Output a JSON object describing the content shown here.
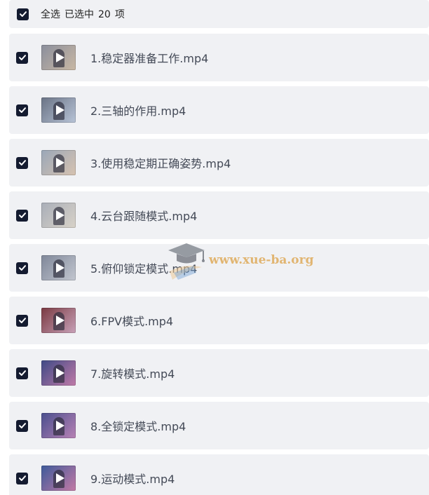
{
  "header": {
    "select_all_label": "全选",
    "selected_label": "已选中",
    "selected_count": "20",
    "count_unit": "项"
  },
  "files": [
    {
      "name": "1.稳定器准备工作.mp4",
      "thumb_colors": [
        "#8a8e9c",
        "#c9b8a4"
      ]
    },
    {
      "name": "2.三轴的作用.mp4",
      "thumb_colors": [
        "#6a7385",
        "#b7c3d6"
      ]
    },
    {
      "name": "3.使用稳定期正确姿势.mp4",
      "thumb_colors": [
        "#9aa7b8",
        "#d6c2b0"
      ]
    },
    {
      "name": "4.云台跟随模式.mp4",
      "thumb_colors": [
        "#a9aeb8",
        "#d8d2c8"
      ]
    },
    {
      "name": "5.俯仰锁定模式.mp4",
      "thumb_colors": [
        "#7f8799",
        "#c2c6cf"
      ]
    },
    {
      "name": "6.FPV模式.mp4",
      "thumb_colors": [
        "#7a3a42",
        "#c8a1b8"
      ]
    },
    {
      "name": "7.旋转模式.mp4",
      "thumb_colors": [
        "#3f4a86",
        "#c07aa8"
      ]
    },
    {
      "name": "8.全锁定模式.mp4",
      "thumb_colors": [
        "#4a4f8e",
        "#b882b5"
      ]
    },
    {
      "name": "9.运动模式.mp4",
      "thumb_colors": [
        "#3e5a9a",
        "#c47aa6"
      ]
    }
  ],
  "watermark": {
    "text": "www.xue-ba.org",
    "icon": "graduation-cap-logo"
  },
  "colors": {
    "checkbox_fill": "#141b30",
    "row_background": "#f0f1f4",
    "file_name_text": "#444a57",
    "watermark_text": "#dca046"
  }
}
